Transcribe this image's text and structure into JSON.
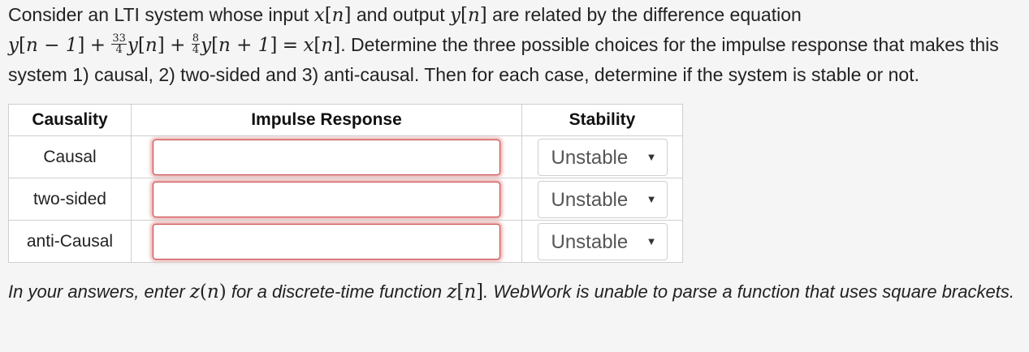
{
  "problem": {
    "intro_text": "Consider an LTI system whose input",
    "input_symbol": "x",
    "index_symbol": "n",
    "and_output_text": "and output",
    "output_symbol": "y",
    "relation_text": "are related by the difference equation",
    "equation": {
      "term1_symbol": "y",
      "term1_index": "n − 1",
      "plus": "+",
      "frac1_num": "33",
      "frac1_den": "4",
      "term2_symbol": "y",
      "term2_index": "n",
      "frac2_num": "8",
      "frac2_den": "4",
      "term3_symbol": "y",
      "term3_index": "n + 1",
      "equals": "=",
      "rhs_symbol": "x",
      "rhs_index": "n"
    },
    "determine_text": ". Determine the three possible choices for the impulse response that makes this",
    "line3_text": "system 1) causal, 2) two-sided and 3) anti-causal. Then for each case, determine if the system is stable or not."
  },
  "table": {
    "headers": {
      "causality": "Causality",
      "impulse": "Impulse Response",
      "stability": "Stability"
    },
    "rows": [
      {
        "causality": "Causal",
        "impulse_value": "",
        "stability": "Unstable"
      },
      {
        "causality": "two-sided",
        "impulse_value": "",
        "stability": "Unstable"
      },
      {
        "causality": "anti-Causal",
        "impulse_value": "",
        "stability": "Unstable"
      }
    ],
    "dropdown_arrow": "▼"
  },
  "note": {
    "part1": "In your answers, enter",
    "fn_symbol": "z",
    "fn_round_arg": "n",
    "part2": "for a discrete-time function",
    "fn_square_arg": "n",
    "part3": ". WebWork is unable to parse a function that uses square brackets."
  },
  "colors": {
    "page_background": "#f5f5f5",
    "invalid_input_glow": "#c94a4a",
    "table_border": "#cfcfcf"
  }
}
